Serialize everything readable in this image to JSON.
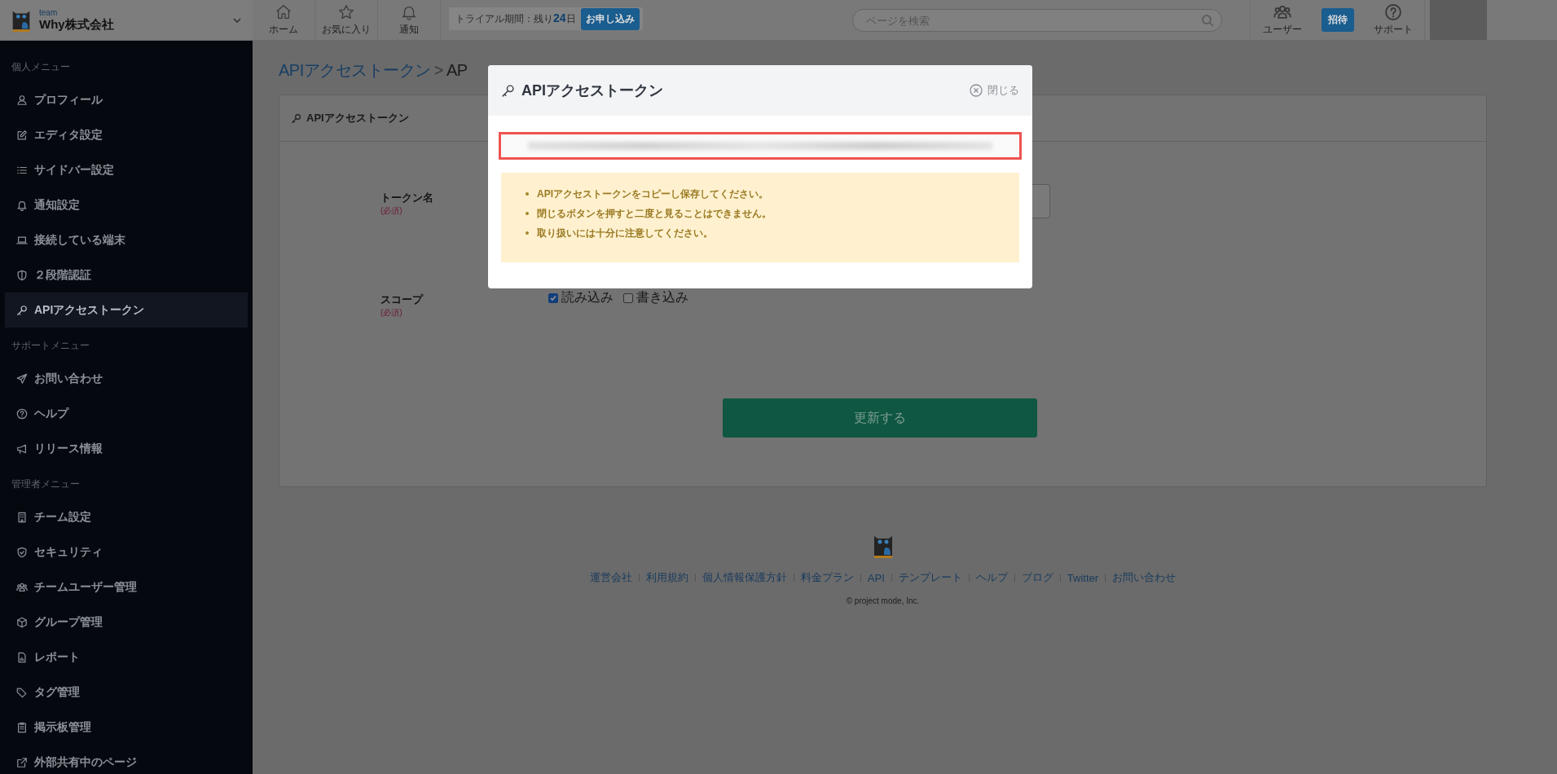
{
  "topbar": {
    "team_label": "team",
    "team_name": "Why株式会社",
    "nav": [
      {
        "label": "ホーム"
      },
      {
        "label": "お気に入り"
      },
      {
        "label": "通知"
      }
    ],
    "trial": {
      "text": "トライアル期間：残り**24**日",
      "button": "お申し込み"
    },
    "search": {
      "placeholder": "ページを検索"
    },
    "users_label": "ユーザー",
    "invite_button": "招待",
    "support_label": "サポート"
  },
  "sidebar": {
    "sections": [
      {
        "title": "個人メニュー",
        "items": [
          {
            "label": "プロフィール",
            "selected": false
          },
          {
            "label": "エディタ設定",
            "selected": false
          },
          {
            "label": "サイドバー設定",
            "selected": false
          },
          {
            "label": "通知設定",
            "selected": false
          },
          {
            "label": "接続している端末",
            "selected": false
          },
          {
            "label": "２段階認証",
            "selected": false
          },
          {
            "label": "APIアクセストークン",
            "selected": true
          }
        ]
      },
      {
        "title": "サポートメニュー",
        "items": [
          {
            "label": "お問い合わせ",
            "selected": false
          },
          {
            "label": "ヘルプ",
            "selected": false
          },
          {
            "label": "リリース情報",
            "selected": false
          }
        ]
      },
      {
        "title": "管理者メニュー",
        "items": [
          {
            "label": "チーム設定",
            "selected": false
          },
          {
            "label": "セキュリティ",
            "selected": false
          },
          {
            "label": "チームユーザー管理",
            "selected": false
          },
          {
            "label": "グループ管理",
            "selected": false
          },
          {
            "label": "レポート",
            "selected": false
          },
          {
            "label": "タグ管理",
            "selected": false
          },
          {
            "label": "掲示板管理",
            "selected": false
          },
          {
            "label": "外部共有中のページ",
            "selected": false
          }
        ]
      }
    ]
  },
  "breadcrumb": {
    "link": "APIアクセストークン",
    "separator": ">",
    "current": "AP"
  },
  "card": {
    "title": "APIアクセストークン",
    "fields": [
      {
        "kind": "input",
        "label": "トークン名",
        "required": "(必須)"
      },
      {
        "kind": "checkboxes",
        "label": "スコープ",
        "required": "(必須)",
        "options": [
          {
            "label": "読み込み",
            "checked": true
          },
          {
            "label": "書き込み",
            "checked": false
          }
        ]
      }
    ],
    "submit": "更新する"
  },
  "modal": {
    "title": "APIアクセストークン",
    "close": "閉じる",
    "notices": [
      "APIアクセストークンをコピーし保存してください。",
      "閉じるボタンを押すと二度と見ることはできません。",
      "取り扱いには十分に注意してください。"
    ]
  },
  "footer": {
    "links": [
      "運営会社",
      "利用規約",
      "個人情報保護方針",
      "料金プラン",
      "API",
      "テンプレート",
      "ヘルプ",
      "ブログ",
      "Twitter",
      "お問い合わせ"
    ],
    "copyright": "© project mode, Inc."
  }
}
